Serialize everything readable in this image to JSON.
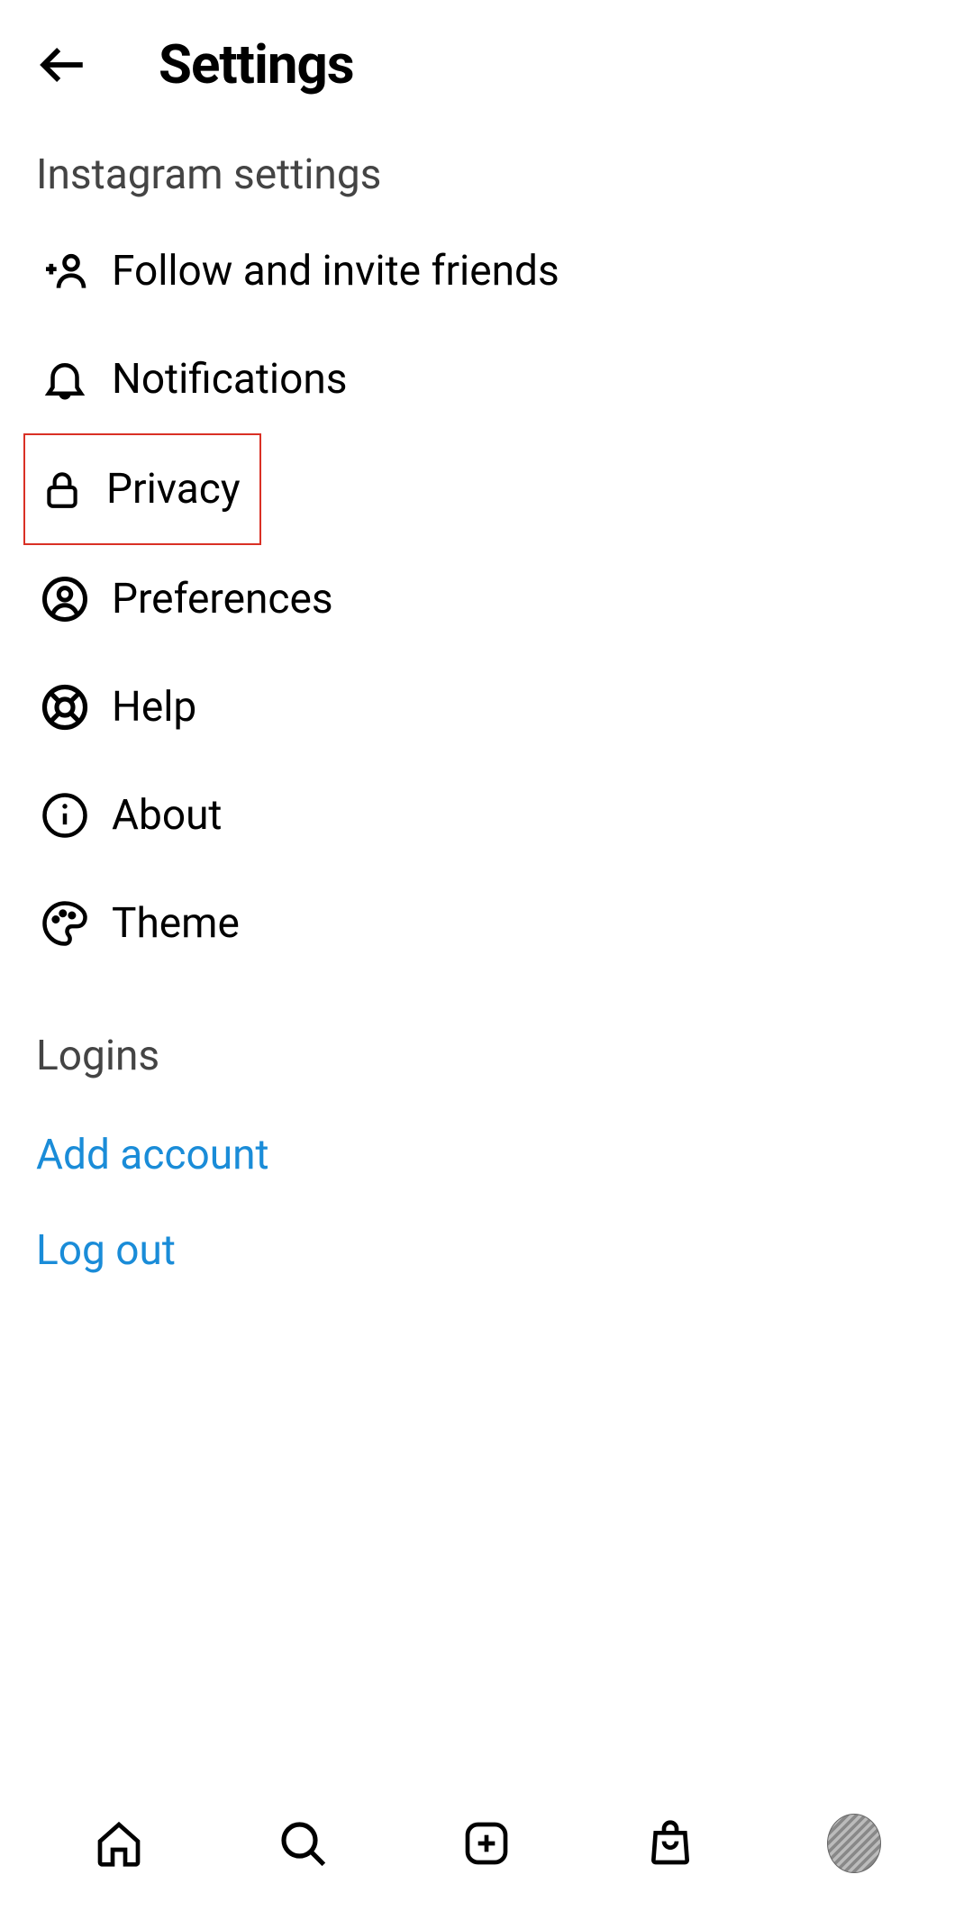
{
  "header": {
    "title": "Settings"
  },
  "sections": {
    "instagram_label": "Instagram settings",
    "logins_label": "Logins"
  },
  "menu": {
    "follow": "Follow and invite friends",
    "notifications": "Notifications",
    "privacy": "Privacy",
    "preferences": "Preferences",
    "help": "Help",
    "about": "About",
    "theme": "Theme"
  },
  "links": {
    "add_account": "Add account",
    "log_out": "Log out"
  }
}
